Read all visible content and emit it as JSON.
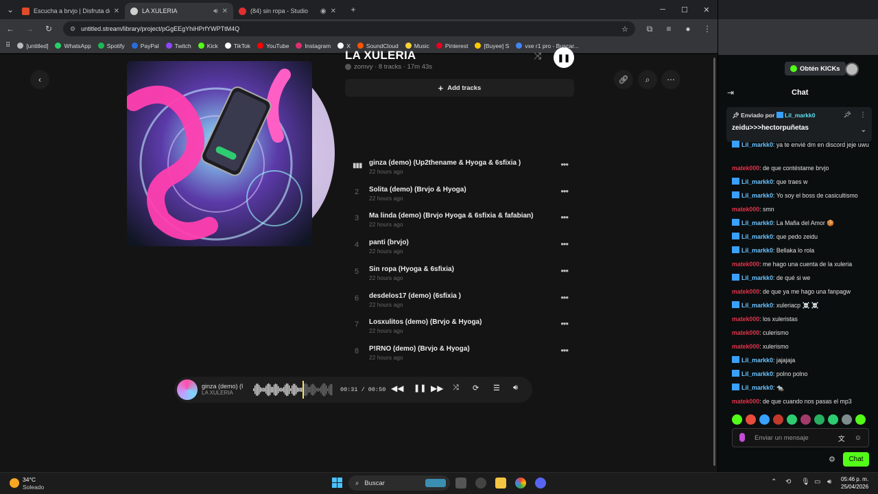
{
  "browser": {
    "tabs": [
      {
        "title": "Escucha a brvjo | Disfruta de á",
        "color": "#e04b2a",
        "active": false
      },
      {
        "title": "LA XULERIA",
        "color": "#cfcfcf",
        "active": true
      },
      {
        "title": "(84) sin ropa - Studio",
        "color": "#e02f2f",
        "active": false
      }
    ],
    "url": "untitled.stream/library/project/pGgEEgYhiHPrfYWPTtM4Q",
    "bookmarks": [
      {
        "label": "[untitled]",
        "color": "#bbbbbb"
      },
      {
        "label": "WhatsApp",
        "color": "#25d366"
      },
      {
        "label": "Spotify",
        "color": "#1db954"
      },
      {
        "label": "PayPal",
        "color": "#2a6cdb"
      },
      {
        "label": "Twitch",
        "color": "#9146ff"
      },
      {
        "label": "Kick",
        "color": "#53fc18"
      },
      {
        "label": "TikTok",
        "color": "#ffffff"
      },
      {
        "label": "YouTube",
        "color": "#ff0000"
      },
      {
        "label": "Instagram",
        "color": "#e1306c"
      },
      {
        "label": "X",
        "color": "#ffffff"
      },
      {
        "label": "SoundCloud",
        "color": "#ff5500"
      },
      {
        "label": "Music",
        "color": "#f5d33a"
      },
      {
        "label": "Pinterest",
        "color": "#e60023"
      },
      {
        "label": "[Buyee] S",
        "color": "#ffcc00"
      },
      {
        "label": "vxe r1 pro - Buscar...",
        "color": "#4285f4"
      }
    ]
  },
  "album": {
    "title": "LA XULERIA",
    "meta": "zomvy · 8 tracks · 17m 43s",
    "add_tracks": "Add tracks"
  },
  "tracks": [
    {
      "num": "",
      "name": "ginza (demo) (Up2thename & Hyoga & 6sfixia )",
      "time": "22 hours ago"
    },
    {
      "num": "2",
      "name": "Solita (demo) (Brvjo & Hyoga)",
      "time": "22 hours ago"
    },
    {
      "num": "3",
      "name": "Ma linda (demo) (Brvjo Hyoga & 6sfixia & fafabian)",
      "time": "22 hours ago"
    },
    {
      "num": "4",
      "name": "panti (brvjo)",
      "time": "22 hours ago"
    },
    {
      "num": "5",
      "name": "Sin ropa (Hyoga & 6sfixia)",
      "time": "22 hours ago"
    },
    {
      "num": "6",
      "name": "desdelos17 (demo) (6sfixia )",
      "time": "22 hours ago"
    },
    {
      "num": "7",
      "name": "Losxulitos (demo) (Brvjo & Hyoga)",
      "time": "22 hours ago"
    },
    {
      "num": "8",
      "name": "P!RNO (demo) (Brvjo & Hyoga)",
      "time": "22 hours ago"
    }
  ],
  "player": {
    "song": "ginza (demo) (U",
    "album": "LA XULERIA",
    "time": "00:31 / 00:50",
    "progress": 0.62
  },
  "chat": {
    "kicks_label": "Obtén KICKs",
    "title": "Chat",
    "pinned_by_prefix": "Enviado por",
    "pinned_user": "Lil_markk0",
    "pinned_msg": "zeidu>>>hectorpuñetas",
    "messages": [
      {
        "user": "Lil_markk0",
        "type": "blue",
        "text": ": ya te envié dm en discord jeje uwu"
      },
      {
        "user": "matek000",
        "type": "red",
        "text": ": de que contéstame brvjo"
      },
      {
        "user": "Lil_markk0",
        "type": "blue",
        "text": ": que traes w"
      },
      {
        "user": "Lil_markk0",
        "type": "blue",
        "text": ": Yo soy el boss de casicultismo"
      },
      {
        "user": "matek000",
        "type": "red",
        "text": ": smn"
      },
      {
        "user": "Lil_markk0",
        "type": "blue",
        "text": ": La Mafia del Amor 🍪"
      },
      {
        "user": "Lil_markk0",
        "type": "blue",
        "text": ": que pedo zeidu"
      },
      {
        "user": "Lil_markk0",
        "type": "blue",
        "text": ": Bellaka lo rola"
      },
      {
        "user": "matek000",
        "type": "red",
        "text": ": me hago una cuenta de la xuleria"
      },
      {
        "user": "Lil_markk0",
        "type": "blue",
        "text": ": de qué si we"
      },
      {
        "user": "matek000",
        "type": "red",
        "text": ": de que ya me hago una fanpagw"
      },
      {
        "user": "Lil_markk0",
        "type": "blue",
        "text": ": xuleriacp ☠️ ☠️"
      },
      {
        "user": "matek000",
        "type": "red",
        "text": ": los xuleristas"
      },
      {
        "user": "matek000",
        "type": "red",
        "text": ": culerismo"
      },
      {
        "user": "matek000",
        "type": "red",
        "text": ": xulerismo"
      },
      {
        "user": "Lil_markk0",
        "type": "blue",
        "text": ": jajajaja"
      },
      {
        "user": "Lil_markk0",
        "type": "blue",
        "text": ": polno polno"
      },
      {
        "user": "Lil_markk0",
        "type": "blue",
        "text": ": 🐀"
      },
      {
        "user": "matek000",
        "type": "red",
        "text": ": de que cuando nos pasas el mp3"
      }
    ],
    "input_placeholder": "Enviar un mensaje",
    "send_label": "Chat"
  },
  "taskbar": {
    "temp": "34°C",
    "condition": "Soleado",
    "search": "Buscar",
    "time": "05:46 p. m.",
    "date": "25/04/2026"
  }
}
